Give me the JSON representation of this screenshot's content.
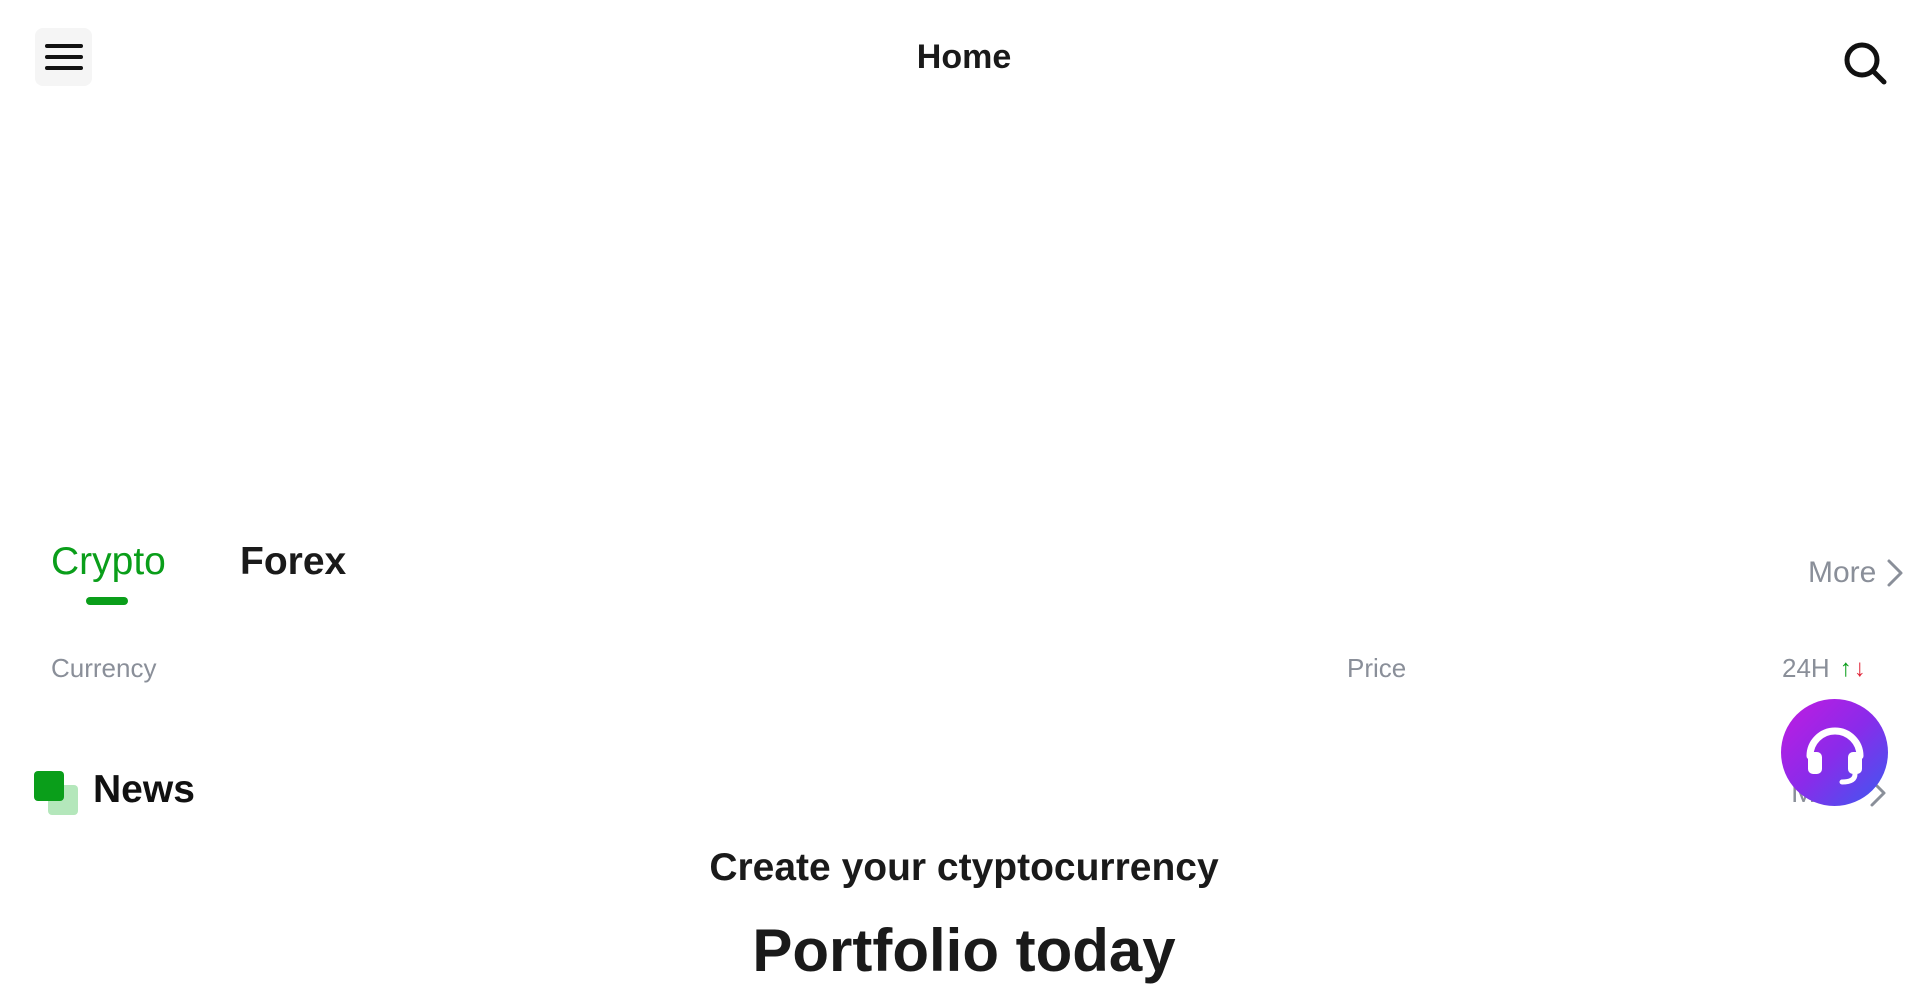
{
  "header": {
    "title": "Home",
    "menu_icon": "hamburger-icon",
    "search_icon": "search-icon"
  },
  "market_tabs": {
    "tabs": [
      {
        "label": "Crypto",
        "active": true
      },
      {
        "label": "Forex",
        "active": false
      }
    ],
    "more_label": "More"
  },
  "market_table": {
    "columns": [
      "Currency",
      "Price",
      "24H"
    ],
    "sort_up_glyph": "↑",
    "sort_down_glyph": "↓"
  },
  "news": {
    "title": "News",
    "more_label": "More"
  },
  "promo": {
    "line1": "Create your ctyptocurrency",
    "line2": "Portfolio today"
  },
  "support": {
    "icon": "headset-icon"
  },
  "colors": {
    "accent": "#0a9e1a",
    "accent_light": "#b4e7bb",
    "muted_text": "#8a8f99",
    "up": "#0a9e1a",
    "down": "#e0263a",
    "support_gradient_start": "#c21be0",
    "support_gradient_end": "#3a5bf0"
  }
}
